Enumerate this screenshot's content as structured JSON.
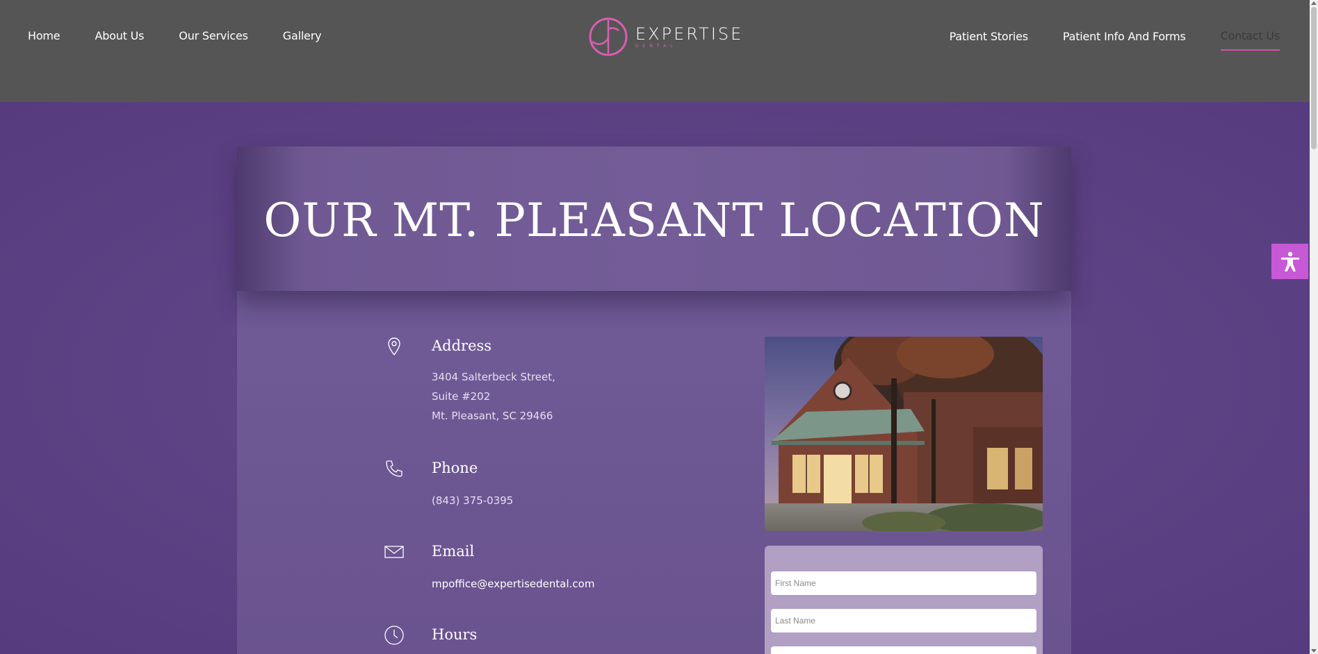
{
  "nav": {
    "left": [
      "Home",
      "About Us",
      "Our Services",
      "Gallery"
    ],
    "right": [
      "Patient Stories",
      "Patient Info And Forms",
      "Contact Us"
    ],
    "active": "Contact Us"
  },
  "logo": {
    "word": "EXPERTISE",
    "sub": "DENTAL"
  },
  "hero": {
    "title": "OUR MT. PLEASANT LOCATION"
  },
  "info": {
    "address": {
      "icon": "map-pin-icon",
      "label": "Address",
      "lines": [
        "3404 Salterbeck Street,",
        "Suite #202",
        "Mt. Pleasant, SC 29466"
      ]
    },
    "phone": {
      "icon": "phone-icon",
      "label": "Phone",
      "lines": [
        "(843) 375-0395"
      ]
    },
    "email": {
      "icon": "envelope-icon",
      "label": "Email",
      "lines": [
        "mpoffice@expertisedental.com"
      ]
    },
    "hours": {
      "icon": "clock-icon",
      "label": "Hours"
    }
  },
  "form": {
    "first_name_placeholder": "First Name",
    "last_name_placeholder": "Last Name",
    "third_placeholder": ""
  },
  "colors": {
    "header_bg": "#555555",
    "accent_pink": "#d44fa6",
    "page_purple": "#5a4283",
    "a11y_button": "#c758d6"
  }
}
